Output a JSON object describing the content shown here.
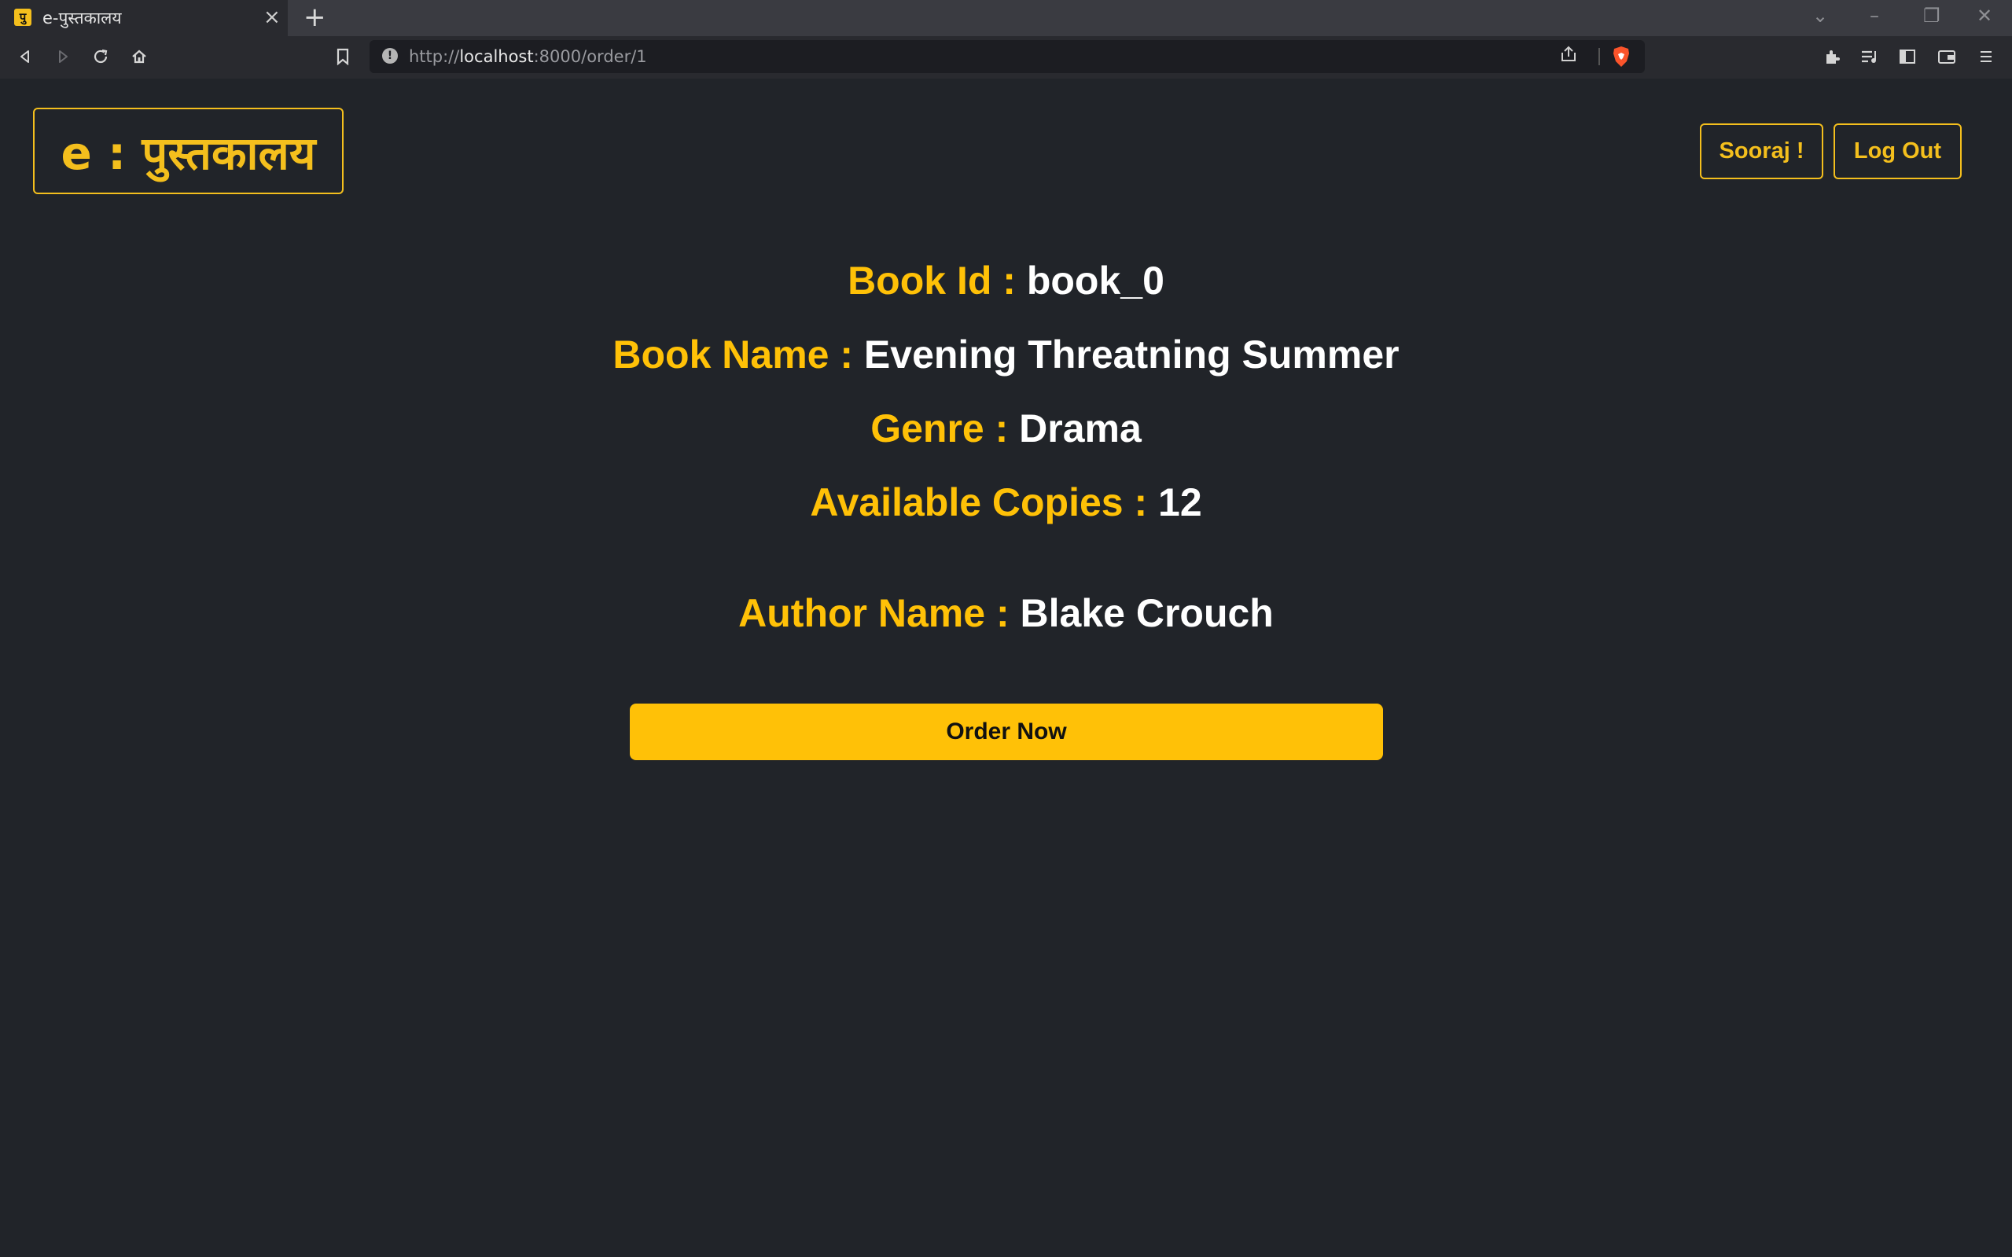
{
  "browser": {
    "tab_title": "e-पुस्तकालय",
    "favicon_glyph": "पु",
    "url_scheme": "http://",
    "url_host": "localhost",
    "url_rest": ":8000/order/1",
    "icons": [
      "back-icon",
      "forward-icon",
      "reload-icon",
      "home-icon",
      "bookmark-icon",
      "site-info-icon",
      "share-icon",
      "brave-shields-icon",
      "extensions-icon",
      "playlist-icon",
      "sidebar-icon",
      "wallet-icon",
      "menu-icon"
    ]
  },
  "header": {
    "brand": "e : पुस्तकालय",
    "user_button": "Sooraj !",
    "logout_button": "Log Out"
  },
  "book": {
    "id_label": "Book Id : ",
    "id_value": "book_0",
    "name_label": "Book Name : ",
    "name_value": "Evening Threatning Summer",
    "genre_label": "Genre : ",
    "genre_value": "Drama",
    "copies_label": "Available Copies : ",
    "copies_value": "12",
    "author_label": "Author Name : ",
    "author_value": "Blake Crouch"
  },
  "actions": {
    "order_button": "Order Now"
  },
  "colors": {
    "accent": "#ffc107",
    "background": "#212429",
    "chrome": "#292a2f"
  }
}
